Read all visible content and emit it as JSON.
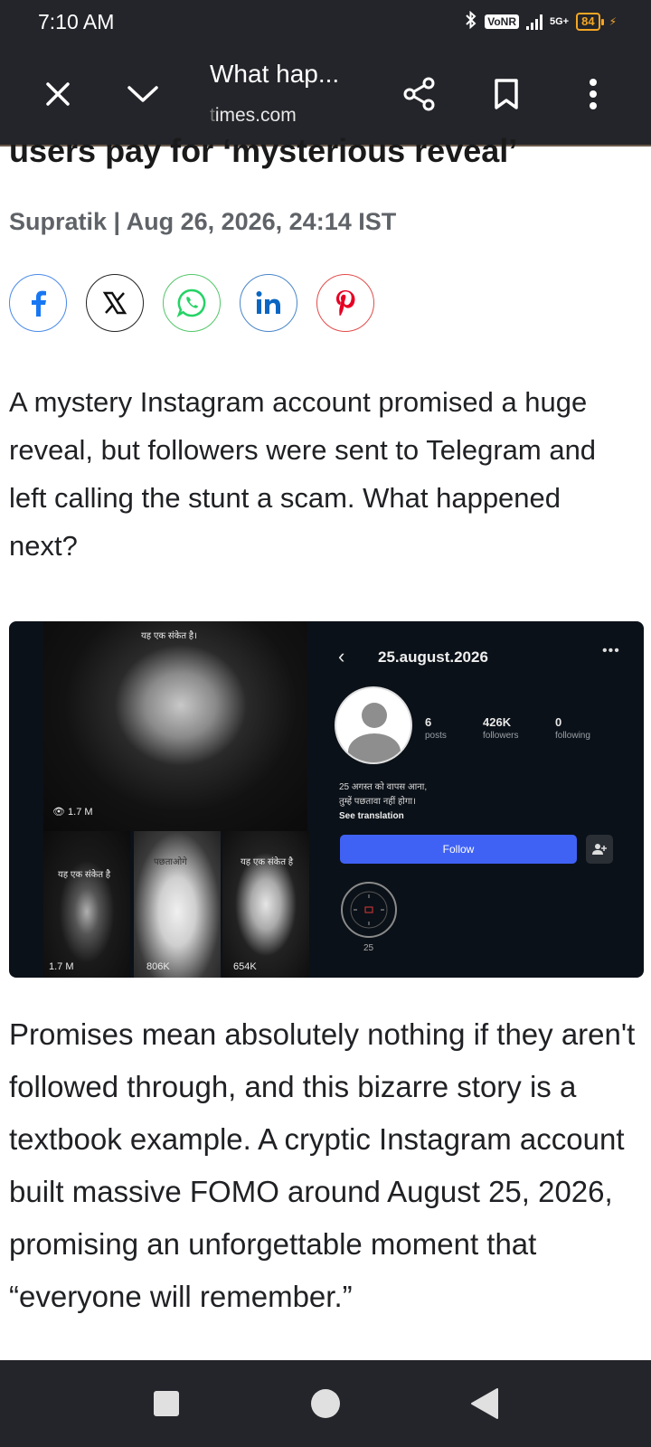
{
  "status_bar": {
    "time": "7:10 AM",
    "bluetooth_icon": "bluetooth-icon",
    "vonr": "VoNR",
    "network": "5G+",
    "battery": "84"
  },
  "browser": {
    "title": "What hap...",
    "url_faded": "t",
    "url": "imes.com",
    "icons": [
      "close-icon",
      "chevron-down-icon",
      "share-icon",
      "bookmark-icon",
      "more-vert-icon"
    ]
  },
  "article": {
    "headline_fragment": "users pay for ‘mysterious reveal’",
    "byline": "Supratik | Aug 26, 2026, 24:14 IST",
    "share_icons": [
      "facebook-icon",
      "x-icon",
      "whatsapp-icon",
      "linkedin-icon",
      "pinterest-icon"
    ],
    "summary": "A mystery Instagram account promised a huge reveal, but followers were sent to Telegram and left calling the stunt a scam. What happened next?",
    "body": "Promises mean absolutely nothing if they aren't followed through, and this bizarre story is a textbook example. A cryptic Instagram account built massive FOMO around August 25, 2026, promising an unforgettable moment that “everyone will remember.”"
  },
  "embed": {
    "big_tile_caption": "यह एक संकेत है।",
    "big_tile_views": "1.7 M",
    "small_tiles": [
      {
        "caption": "यह एक संकेत है",
        "views": "1.7 M"
      },
      {
        "caption": "पछताओगे",
        "views": "806K"
      },
      {
        "caption": "यह एक संकेत है",
        "views": "654K"
      }
    ],
    "profile": {
      "handle": "25.august.2026",
      "more": "•••",
      "stats": [
        {
          "num": "6",
          "label": "posts"
        },
        {
          "num": "426K",
          "label": "followers"
        },
        {
          "num": "0",
          "label": "following"
        }
      ],
      "bio_line1": "25 अगस्त को वापस आना,",
      "bio_line2": "तुम्हें पछतावा नहीं होगा।",
      "see_translation": "See translation",
      "follow": "Follow",
      "highlight_label": "25"
    }
  },
  "nav_bar": {
    "icons": [
      "recents-square-icon",
      "home-circle-icon",
      "back-triangle-icon"
    ]
  }
}
